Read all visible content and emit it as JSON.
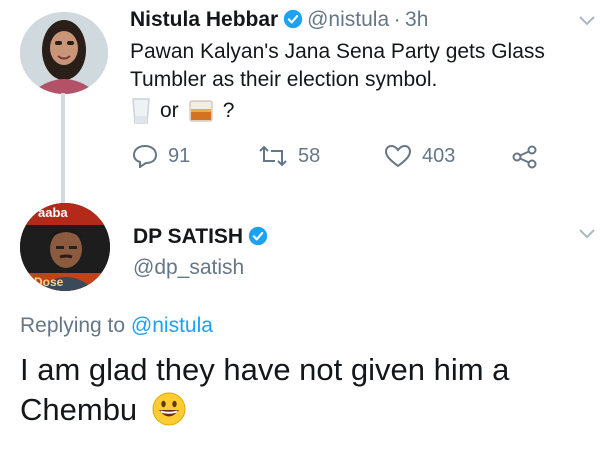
{
  "tweet1": {
    "name": "Nistula Hebbar",
    "handle": "@nistula",
    "separator": "·",
    "time": "3h",
    "text": "Pawan Kalyan's Jana Sena Party gets Glass Tumbler as their election symbol.",
    "or_word": "or",
    "question_mark": "?",
    "stats": {
      "replies": "91",
      "retweets": "58",
      "likes": "403"
    }
  },
  "tweet2": {
    "name": "DP SATISH",
    "handle": "@dp_satish",
    "avatar_caption_top": "aaba",
    "avatar_caption_bottom": "Dose",
    "replying_prefix": "Replying to",
    "replying_handle": "@nistula",
    "text": "I am glad they have not given him a Chembu"
  },
  "colors": {
    "verified": "#1da1f2",
    "secondary": "#657786",
    "link": "#1da1f2",
    "thread": "#cfd9de"
  },
  "icons": [
    "verified-badge-icon",
    "chevron-down-icon",
    "reply-icon",
    "retweet-icon",
    "like-heart-icon",
    "share-icon",
    "glass-emoji-icon",
    "whisky-emoji-icon",
    "grinning-emoji-icon"
  ]
}
